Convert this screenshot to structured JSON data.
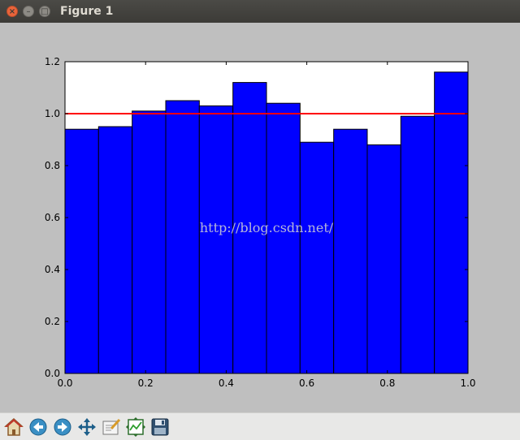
{
  "window": {
    "title": "Figure 1",
    "controls": {
      "close": "×",
      "minimize": "–",
      "maximize": "□"
    }
  },
  "chart_data": {
    "type": "bar",
    "title": "",
    "xlabel": "",
    "ylabel": "",
    "xlim": [
      0.0,
      1.0
    ],
    "ylim": [
      0.0,
      1.2
    ],
    "x_ticks": [
      "0.0",
      "0.2",
      "0.4",
      "0.6",
      "0.8",
      "1.0"
    ],
    "y_ticks": [
      "0.0",
      "0.2",
      "0.4",
      "0.6",
      "0.8",
      "1.0",
      "1.2"
    ],
    "bin_edges": [
      0.0,
      0.0833,
      0.1667,
      0.25,
      0.3333,
      0.4167,
      0.5,
      0.5833,
      0.6667,
      0.75,
      0.8333,
      0.9167,
      1.0
    ],
    "values": [
      0.94,
      0.95,
      1.01,
      1.05,
      1.03,
      1.12,
      1.04,
      0.89,
      0.94,
      0.88,
      0.99,
      1.16
    ],
    "bar_color": "#0000ff",
    "reference_line": {
      "y": 1.0,
      "color": "#ff0000"
    },
    "grid": false,
    "watermark": "http://blog.csdn.net/"
  },
  "toolbar": {
    "buttons": [
      {
        "name": "home-icon"
      },
      {
        "name": "back-icon"
      },
      {
        "name": "forward-icon"
      },
      {
        "name": "pan-icon"
      },
      {
        "name": "zoom-icon"
      },
      {
        "name": "subplots-icon"
      },
      {
        "name": "save-icon"
      }
    ]
  },
  "colors": {
    "figure_bg": "#bfbfbf",
    "axes_bg": "#ffffff",
    "titlebar": "#3c3b37"
  }
}
